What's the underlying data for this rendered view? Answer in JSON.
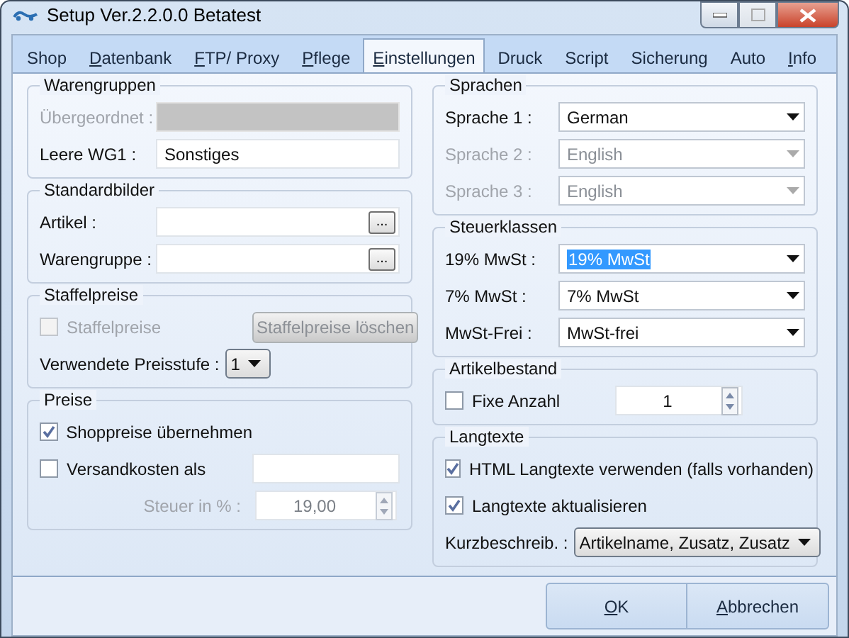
{
  "window": {
    "title": "Setup Ver.2.2.0.0 Betatest",
    "maximize_disabled": true
  },
  "tabs": [
    {
      "label": "Shop",
      "selected": false,
      "mnemonic": false
    },
    {
      "label": "Datenbank",
      "selected": false,
      "mnemonic": true
    },
    {
      "label": "FTP/ Proxy",
      "selected": false,
      "mnemonic": true
    },
    {
      "label": "Pflege",
      "selected": false,
      "mnemonic": true
    },
    {
      "label": "Einstellungen",
      "selected": true,
      "mnemonic": true
    },
    {
      "label": "Druck",
      "selected": false,
      "mnemonic": false
    },
    {
      "label": "Script",
      "selected": false,
      "mnemonic": false
    },
    {
      "label": "Sicherung",
      "selected": false,
      "mnemonic": false
    },
    {
      "label": "Auto",
      "selected": false,
      "mnemonic": false
    },
    {
      "label": "Info",
      "selected": false,
      "mnemonic": true
    }
  ],
  "left_groups": [
    {
      "title": "Warengruppen",
      "rows": [
        {
          "kind": "field",
          "label": "Übergeordnet :",
          "disabled": true
        },
        {
          "kind": "field",
          "label": "Leere WG1 :",
          "value": "Sonstiges",
          "disabled": false
        }
      ]
    },
    {
      "title": "Standardbilder",
      "rows": [
        {
          "kind": "field",
          "label": "Artikel :",
          "disabled": false,
          "browse": "..."
        },
        {
          "kind": "field",
          "label": "Warengruppe :",
          "disabled": false,
          "browse": "..."
        }
      ]
    },
    {
      "title": "Staffelpreise",
      "rows": [
        {
          "kind": "checkbox",
          "label": "Staffelpreise",
          "checked": false,
          "disabled": true,
          "button": {
            "label": "Staffelpreise löschen",
            "disabled": true
          }
        },
        {
          "kind": "select",
          "label": "Verwendete Preisstufe :",
          "value": "1",
          "disabled": false,
          "raised": true
        }
      ]
    },
    {
      "title": "Preise",
      "rows": [
        {
          "kind": "checkbox",
          "label": "Shoppreise übernehmen",
          "checked": true,
          "disabled": false
        },
        {
          "kind": "checkbox",
          "label": "Versandkosten als",
          "checked": false,
          "disabled": false,
          "with_field": true
        },
        {
          "kind": "spin",
          "label": "Steuer in % :",
          "value": "19,00",
          "disabled": true
        }
      ]
    }
  ],
  "right_groups": [
    {
      "title": "Sprachen",
      "rows": [
        {
          "kind": "select",
          "label": "Sprache 1 :",
          "value": "German",
          "disabled": false
        },
        {
          "kind": "select",
          "label": "Sprache 2 :",
          "value": "English",
          "disabled": true
        },
        {
          "kind": "select",
          "label": "Sprache 3 :",
          "value": "English",
          "disabled": true
        }
      ]
    },
    {
      "title": "Steuerklassen",
      "rows": [
        {
          "kind": "select",
          "label": "19% MwSt :",
          "value": "19% MwSt",
          "disabled": false,
          "highlighted": true
        },
        {
          "kind": "select",
          "label": "7% MwSt :",
          "value": "7% MwSt",
          "disabled": false
        },
        {
          "kind": "select",
          "label": "MwSt-Frei :",
          "value": "MwSt-frei",
          "disabled": false
        }
      ]
    },
    {
      "title": "Artikelbestand",
      "rows": [
        {
          "kind": "checkbox",
          "label": "Fixe Anzahl",
          "checked": false,
          "disabled": false,
          "spin": {
            "value": "1",
            "disabled": false
          }
        }
      ]
    },
    {
      "title": "Langtexte",
      "rows": [
        {
          "kind": "checkbox",
          "label": "HTML Langtexte verwenden (falls vorhanden)",
          "checked": true,
          "disabled": false
        },
        {
          "kind": "checkbox",
          "label": "Langtexte aktualisieren",
          "checked": true,
          "disabled": false
        },
        {
          "kind": "select",
          "label": "Kurzbeschreib. :",
          "value": "Artikelname, Zusatz, Zusatz",
          "disabled": false,
          "raised": true
        }
      ]
    }
  ],
  "buttons": [
    {
      "label": "OK",
      "mnemonic": true
    },
    {
      "label": "Abbrechen",
      "mnemonic": true
    }
  ]
}
